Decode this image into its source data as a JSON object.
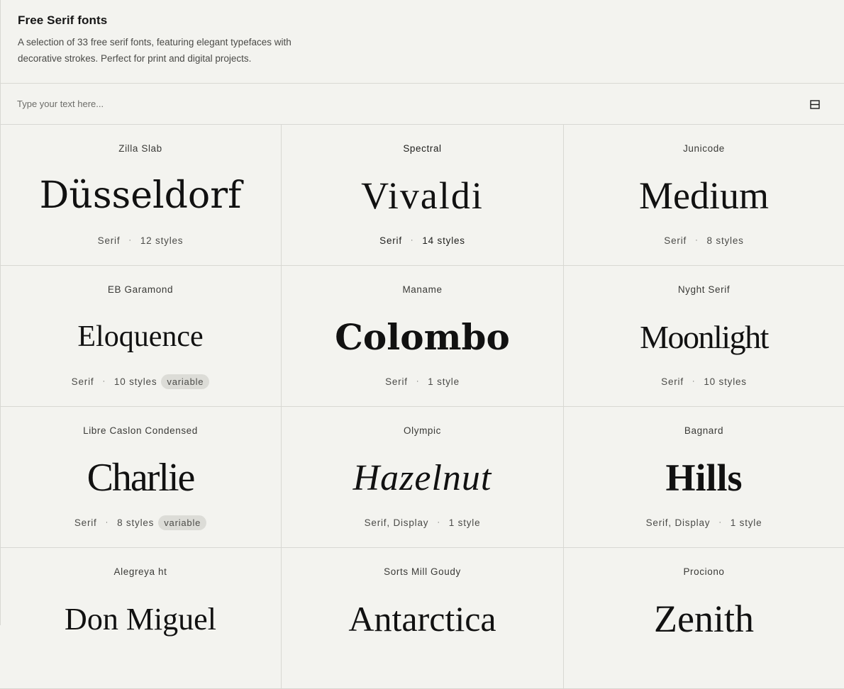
{
  "header": {
    "title": "Free Serif fonts",
    "description": "A selection of 33 free serif fonts, featuring elegant typefaces with decorative strokes. Perfect for print and digital projects."
  },
  "search": {
    "placeholder": "Type your text here...",
    "value": "",
    "layout_toggle_icon": "layout-toggle-icon"
  },
  "fonts": [
    {
      "name": "Zilla Slab",
      "sample": "Düsseldorf",
      "category": "Serif",
      "styles": "12 styles",
      "badge": ""
    },
    {
      "name": "Spectral",
      "sample": "Vivaldi",
      "category": "Serif",
      "styles": "14 styles",
      "badge": ""
    },
    {
      "name": "Junicode",
      "sample": "Medium",
      "category": "Serif",
      "styles": "8 styles",
      "badge": ""
    },
    {
      "name": "EB Garamond",
      "sample": "Eloquence",
      "category": "Serif",
      "styles": "10 styles",
      "badge": "variable"
    },
    {
      "name": "Maname",
      "sample": "Colombo",
      "category": "Serif",
      "styles": "1 style",
      "badge": ""
    },
    {
      "name": "Nyght Serif",
      "sample": "Moonlight",
      "category": "Serif",
      "styles": "10 styles",
      "badge": ""
    },
    {
      "name": "Libre Caslon Condensed",
      "sample": "Charlie",
      "category": "Serif",
      "styles": "8 styles",
      "badge": "variable"
    },
    {
      "name": "Olympic",
      "sample": "Hazelnut",
      "category": "Serif, Display",
      "styles": "1 style",
      "badge": ""
    },
    {
      "name": "Bagnard",
      "sample": "Hills",
      "category": "Serif, Display",
      "styles": "1 style",
      "badge": ""
    },
    {
      "name": "Alegreya ht",
      "sample": "Don Miguel",
      "category": "",
      "styles": "",
      "badge": ""
    },
    {
      "name": "Sorts Mill Goudy",
      "sample": "Antarctica",
      "category": "",
      "styles": "",
      "badge": ""
    },
    {
      "name": "Prociono",
      "sample": "Zenith",
      "category": "",
      "styles": "",
      "badge": ""
    }
  ]
}
